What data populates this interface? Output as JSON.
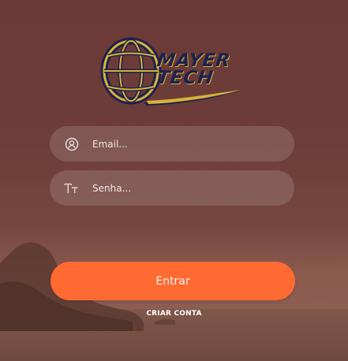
{
  "logo": {
    "line1": "MAYER",
    "line2": "TECH",
    "colors": {
      "globe_gold": "#d8b338",
      "globe_navy": "#1c2250"
    }
  },
  "form": {
    "email": {
      "placeholder": "Email...",
      "value": "",
      "icon": "user-circle-icon"
    },
    "password": {
      "placeholder": "Senha...",
      "value": "",
      "icon": "text-format-icon"
    },
    "submit_label": "Entrar",
    "create_account_label": "CRIAR CONTA"
  },
  "theme": {
    "accent": "#ff6a33",
    "background": "#6b3a37"
  }
}
